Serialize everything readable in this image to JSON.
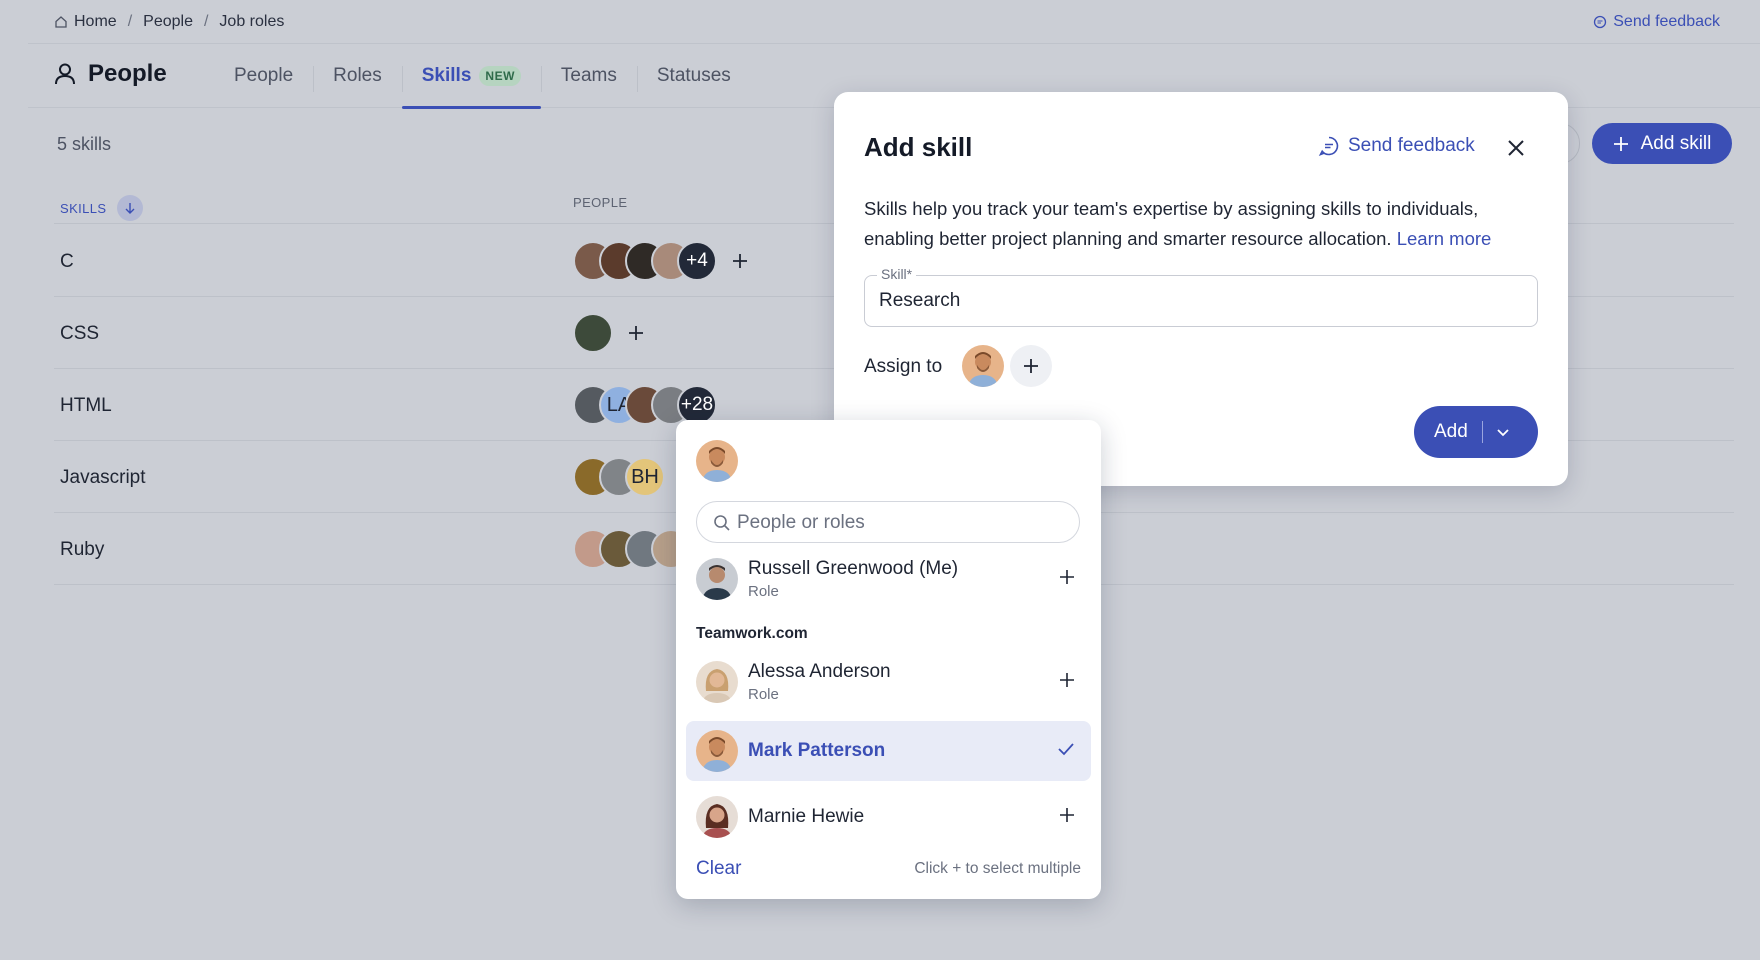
{
  "breadcrumb": {
    "items": [
      "Home",
      "People",
      "Job roles"
    ],
    "separator": "/"
  },
  "top_feedback": "Send feedback",
  "page_title": "People",
  "tabs": [
    {
      "label": "People"
    },
    {
      "label": "Roles"
    },
    {
      "label": "Skills",
      "badge": "NEW",
      "active": true
    },
    {
      "label": "Teams"
    },
    {
      "label": "Statuses"
    }
  ],
  "skills_count": "5 skills",
  "add_skill_button": "Add skill",
  "table": {
    "headers": {
      "skills": "SKILLS",
      "people": "PEOPLE"
    },
    "rows": [
      {
        "name": "C",
        "avatars": [
          "#7a5a4a",
          "#5b3b2c",
          "#2f2a26",
          "#a88a7a"
        ],
        "initials": [],
        "more": "+4"
      },
      {
        "name": "CSS",
        "avatars": [
          "#3d4a3a"
        ],
        "initials": [],
        "more": ""
      },
      {
        "name": "HTML",
        "avatars": [
          "#555a60"
        ],
        "initials": [
          "LA"
        ],
        "initials_colors": [
          "#8fb0e0"
        ],
        "extra_avatars": [
          "#6a4a3a",
          "#7a7d82"
        ],
        "more": "+28"
      },
      {
        "name": "Javascript",
        "avatars": [
          "#8a6a2a",
          "#808488"
        ],
        "initials": [
          "BH"
        ],
        "initials_colors": [
          "#e3c57a"
        ],
        "more": ""
      },
      {
        "name": "Ruby",
        "avatars": [
          "#c29a8a",
          "#6a5a3a",
          "#707880",
          "#b8a08a"
        ],
        "initials": [],
        "more": ""
      }
    ]
  },
  "modal": {
    "title": "Add skill",
    "feedback": "Send feedback",
    "description": "Skills help you track your team's expertise by assigning skills to individuals, enabling better project planning and smarter resource allocation.",
    "learn_more": "Learn more",
    "skill_label": "Skill*",
    "skill_value": "Research",
    "assign_label": "Assign to",
    "add_button": "Add"
  },
  "dropdown": {
    "search_placeholder": "People or roles",
    "me": {
      "name": "Russell Greenwood (Me)",
      "role": "Role"
    },
    "group": "Teamwork.com",
    "people": [
      {
        "name": "Alessa Anderson",
        "role": "Role",
        "selected": false
      },
      {
        "name": "Mark Patterson",
        "role": "",
        "selected": true
      },
      {
        "name": "Marnie Hewie",
        "role": "",
        "selected": false
      }
    ],
    "clear": "Clear",
    "hint": "Click + to select multiple"
  },
  "colors": {
    "accent": "#3b4fb5",
    "backdrop": "#cbced5",
    "selected_row": "#e8ebf7",
    "badge_bg": "#b6d4c0",
    "badge_text": "#2f6b4a"
  }
}
